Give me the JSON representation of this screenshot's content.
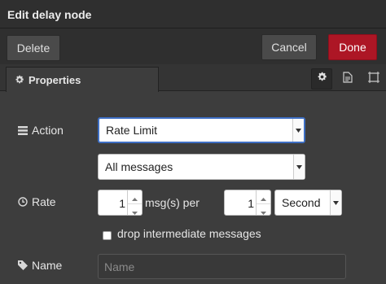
{
  "header": {
    "title": "Edit delay node"
  },
  "toolbar": {
    "delete_label": "Delete",
    "cancel_label": "Cancel",
    "done_label": "Done"
  },
  "tabs": {
    "properties_label": "Properties",
    "icons": [
      "gear-icon",
      "document-icon",
      "frame-icon"
    ]
  },
  "form": {
    "action": {
      "label": "Action",
      "selected": "Rate Limit",
      "scope_selected": "All messages"
    },
    "rate": {
      "label": "Rate",
      "count": "1",
      "count_suffix": "msg(s) per",
      "period": "1",
      "unit_selected": "Second"
    },
    "drop": {
      "label": "drop intermediate messages",
      "checked": false
    },
    "name": {
      "label": "Name",
      "value": "",
      "placeholder": "Name"
    }
  },
  "colors": {
    "background": "#3d3d3d",
    "header": "#2f2f2f",
    "done_button": "#ad1625",
    "focus_border": "#3e6fc4"
  }
}
